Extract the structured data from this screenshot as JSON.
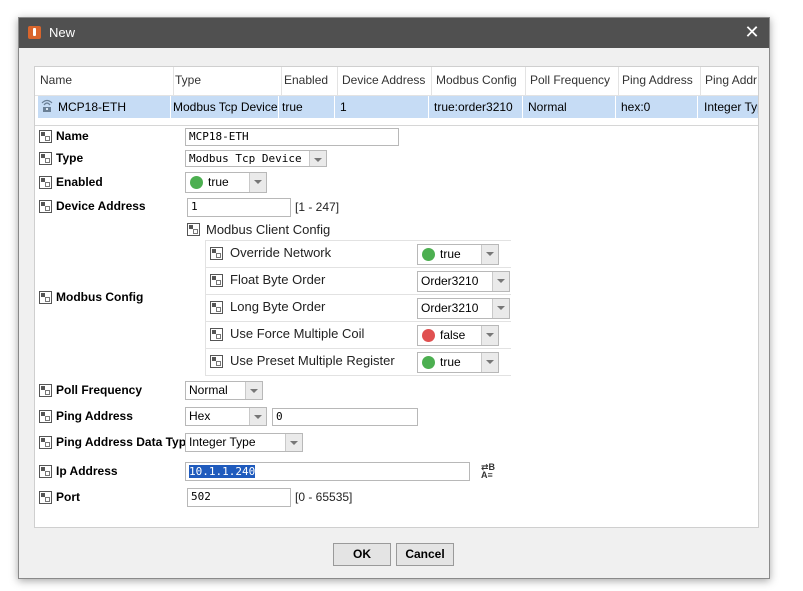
{
  "window": {
    "title": "New",
    "close_icon": "close-icon"
  },
  "table": {
    "columns": [
      "Name",
      "Type",
      "Enabled",
      "Device Address",
      "Modbus Config",
      "Poll Frequency",
      "Ping Address",
      "Ping Addr"
    ],
    "row": [
      "MCP18-ETH",
      "Modbus Tcp Device",
      "true",
      "1",
      "true:order3210",
      "Normal",
      "hex:0",
      "Integer Typ"
    ]
  },
  "props": {
    "name": {
      "label": "Name",
      "value": "MCP18-ETH"
    },
    "type": {
      "label": "Type",
      "value": "Modbus Tcp Device"
    },
    "enabled": {
      "label": "Enabled",
      "value": "true",
      "color": "#4caf50"
    },
    "device_address": {
      "label": "Device Address",
      "value": "1",
      "range": "[1 - 247]"
    },
    "modbus_config": {
      "label": "Modbus Config",
      "group_label": "Modbus Client Config",
      "items": [
        {
          "label": "Override Network",
          "value": "true",
          "color": "#4caf50"
        },
        {
          "label": "Float Byte Order",
          "value": "Order3210"
        },
        {
          "label": "Long Byte Order",
          "value": "Order3210"
        },
        {
          "label": "Use Force Multiple Coil",
          "value": "false",
          "color": "#e05050"
        },
        {
          "label": "Use Preset Multiple Register",
          "value": "true",
          "color": "#4caf50"
        }
      ]
    },
    "poll_frequency": {
      "label": "Poll Frequency",
      "value": "Normal"
    },
    "ping_address": {
      "label": "Ping Address",
      "type_value": "Hex",
      "value": "0"
    },
    "ping_address_data_type": {
      "label": "Ping Address Data Type",
      "value": "Integer Type"
    },
    "ip_address": {
      "label": "Ip Address",
      "value": "10.1.1.240",
      "format_icon_text_top": "⇄B",
      "format_icon_text_bottom": "A≡"
    },
    "port": {
      "label": "Port",
      "value": "502",
      "range": "[0 - 65535]"
    }
  },
  "buttons": {
    "ok": "OK",
    "cancel": "Cancel"
  }
}
